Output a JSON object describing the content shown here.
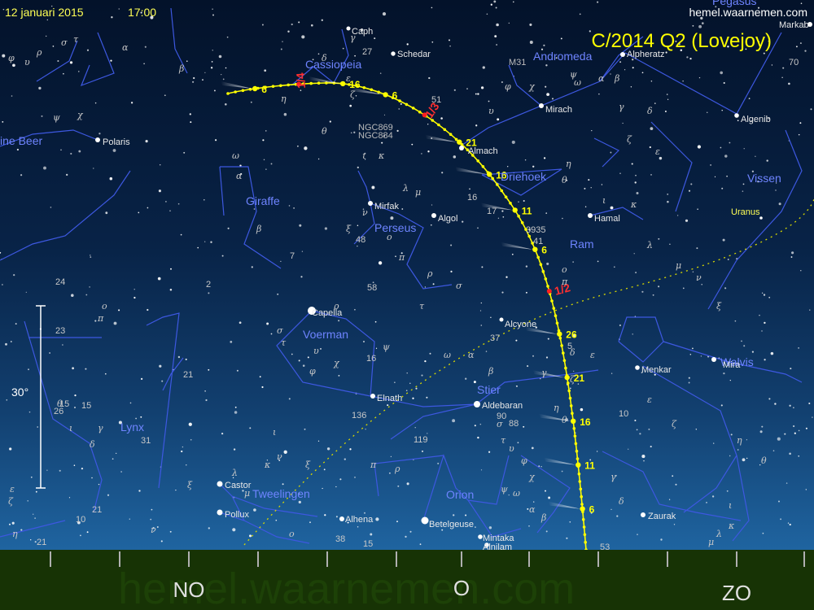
{
  "header": {
    "date": "12 januari 2015",
    "time": "17:00",
    "site": "hemel.waarnemen.com",
    "comet_title": "C/2014 Q2 (Lovejoy)"
  },
  "watermark": "hemel.waarnemen.com",
  "scale": {
    "label": "30°"
  },
  "horizon": {
    "directions": [
      {
        "key": "no",
        "label": "NO"
      },
      {
        "key": "o",
        "label": "O"
      },
      {
        "key": "zo",
        "label": "ZO"
      }
    ]
  },
  "constellations": {
    "cassiopeia": "Cassiopeia",
    "andromeda": "Andromeda",
    "kleine_beer": "ine Beer",
    "giraffe": "Giraffe",
    "perseus": "Perseus",
    "driehoek": "Driehoek",
    "vissen": "Vissen",
    "ram": "Ram",
    "voerman": "Voerman",
    "walvis": "Walvis",
    "lynx": "Lynx",
    "stier": "Stier",
    "tweelingen": "Tweelingen",
    "orion": "Orion",
    "pegasus": "Pegasus"
  },
  "stars": {
    "caph": "Caph",
    "schedar": "Schedar",
    "alpheratz": "Alpheratz",
    "markab": "Markab",
    "mirach": "Mirach",
    "algenib": "Algenib",
    "polaris": "Polaris",
    "almach": "Almach",
    "mirfak": "Mirfak",
    "algol": "Algol",
    "hamal": "Hamal",
    "capella": "Capella",
    "alcyone": "Alcyone",
    "menkar": "Menkar",
    "mira": "Mira",
    "elnath": "Elnath",
    "aldebaran": "Aldebaran",
    "castor": "Castor",
    "pollux": "Pollux",
    "alhena": "Alhena",
    "betelgeuse": "Betelgeuse",
    "mintaka": "Mintaka",
    "alnilam": "Alnilam",
    "zaurak": "Zaurak"
  },
  "deep_sky": {
    "m31": "M31",
    "ngc869": "NGC869",
    "ngc884": "NGC884"
  },
  "planets": {
    "uranus": "Uranus"
  },
  "comet_path": {
    "date_labels": [
      {
        "text": "6",
        "color": "#ffff00"
      },
      {
        "text": "11",
        "color": "#ffff00"
      },
      {
        "text": "16",
        "color": "#ffff00"
      },
      {
        "text": "21",
        "color": "#ffff00"
      },
      {
        "text": "26",
        "color": "#ffff00"
      },
      {
        "text": "1/2",
        "color": "#ff3030"
      },
      {
        "text": "6",
        "color": "#ffff00"
      },
      {
        "text": "11",
        "color": "#ffff00"
      },
      {
        "text": "16",
        "color": "#ffff00"
      },
      {
        "text": "21",
        "color": "#ffff00"
      },
      {
        "text": "1/3",
        "color": "#ff3030"
      },
      {
        "text": "6",
        "color": "#ffff00"
      },
      {
        "text": "16",
        "color": "#ffff00"
      },
      {
        "text": "1/4",
        "color": "#ff3030"
      },
      {
        "text": "6",
        "color": "#ffff00"
      }
    ]
  },
  "greek_labels": [
    "α",
    "β",
    "γ",
    "δ",
    "ε",
    "ζ",
    "η",
    "θ",
    "ι",
    "κ",
    "λ",
    "μ",
    "ν",
    "ξ",
    "ο",
    "π",
    "ρ",
    "σ",
    "τ",
    "υ",
    "φ",
    "χ",
    "ψ",
    "ω"
  ],
  "number_labels": [
    "24",
    "23",
    "15",
    "21",
    "31",
    "26",
    "15",
    "58",
    "48",
    "7",
    "16",
    "37",
    "136",
    "119",
    "90",
    "88",
    "10",
    "5",
    "70",
    "3935",
    "41",
    "2",
    "17",
    "16",
    "51",
    "27",
    "10",
    "21",
    "38",
    "15",
    "53",
    "21"
  ],
  "colors": {
    "sky_top": "#03122a",
    "sky_horizon": "#1c5f99",
    "ground": "#173305",
    "constellation_line": "#3d58e0",
    "constellation_label": "#6e84ff",
    "comet_path": "#ffff00",
    "month_mark": "#ff2020",
    "ecliptic": "#d9d900"
  }
}
